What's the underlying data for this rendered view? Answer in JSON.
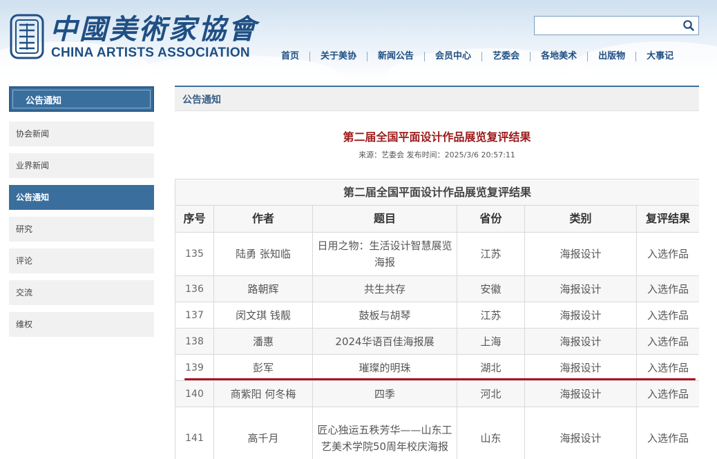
{
  "header": {
    "logo_cn": "中國美術家協會",
    "logo_en": "CHINA ARTISTS ASSOCIATION",
    "search": {
      "value": "",
      "placeholder": ""
    },
    "nav": [
      "首页",
      "关于美协",
      "新闻公告",
      "会员中心",
      "艺委会",
      "各地美术",
      "出版物",
      "大事记"
    ]
  },
  "sidebar": {
    "title": "公告通知",
    "items": [
      "协会新闻",
      "业界新闻",
      "公告通知",
      "研究",
      "评论",
      "交流",
      "维权"
    ],
    "active_index": 2
  },
  "main": {
    "section_title": "公告通知",
    "article_title": "第二届全国平面设计作品展览复评结果",
    "meta": "来源：艺委会 发布时间：2025/3/6 20:57:11"
  },
  "table": {
    "caption": "第二届全国平面设计作品展览复评结果",
    "headers": [
      "序号",
      "作者",
      "题目",
      "省份",
      "类别",
      "复评结果"
    ],
    "rows": [
      [
        "135",
        "陆勇  张知临",
        "日用之物：生活设计智慧展览海报",
        "江苏",
        "海报设计",
        "入选作品"
      ],
      [
        "136",
        "路朝辉",
        "共生共存",
        "安徽",
        "海报设计",
        "入选作品"
      ],
      [
        "137",
        "闵文琪  钱靓",
        "鼓板与胡琴",
        "江苏",
        "海报设计",
        "入选作品"
      ],
      [
        "138",
        "潘惠",
        "2024华语百佳海报展",
        "上海",
        "海报设计",
        "入选作品"
      ],
      [
        "139",
        "彭军",
        "璀璨的明珠",
        "湖北",
        "海报设计",
        "入选作品"
      ],
      [
        "140",
        "商紫阳  何冬梅",
        "四季",
        "河北",
        "海报设计",
        "入选作品"
      ],
      [
        "141",
        "高千月",
        "匠心独运五秩芳华——山东工艺美术学院50周年校庆海报",
        "山东",
        "海报设计",
        "入选作品"
      ]
    ]
  },
  "colors": {
    "brand_blue": "#1f4f83",
    "sidebar_active": "#3a6e9d",
    "title_red": "#9c1a1a",
    "highlight_line": "#b0101e"
  },
  "icons": {
    "search": "search-icon",
    "logo": "association-emblem-icon"
  }
}
